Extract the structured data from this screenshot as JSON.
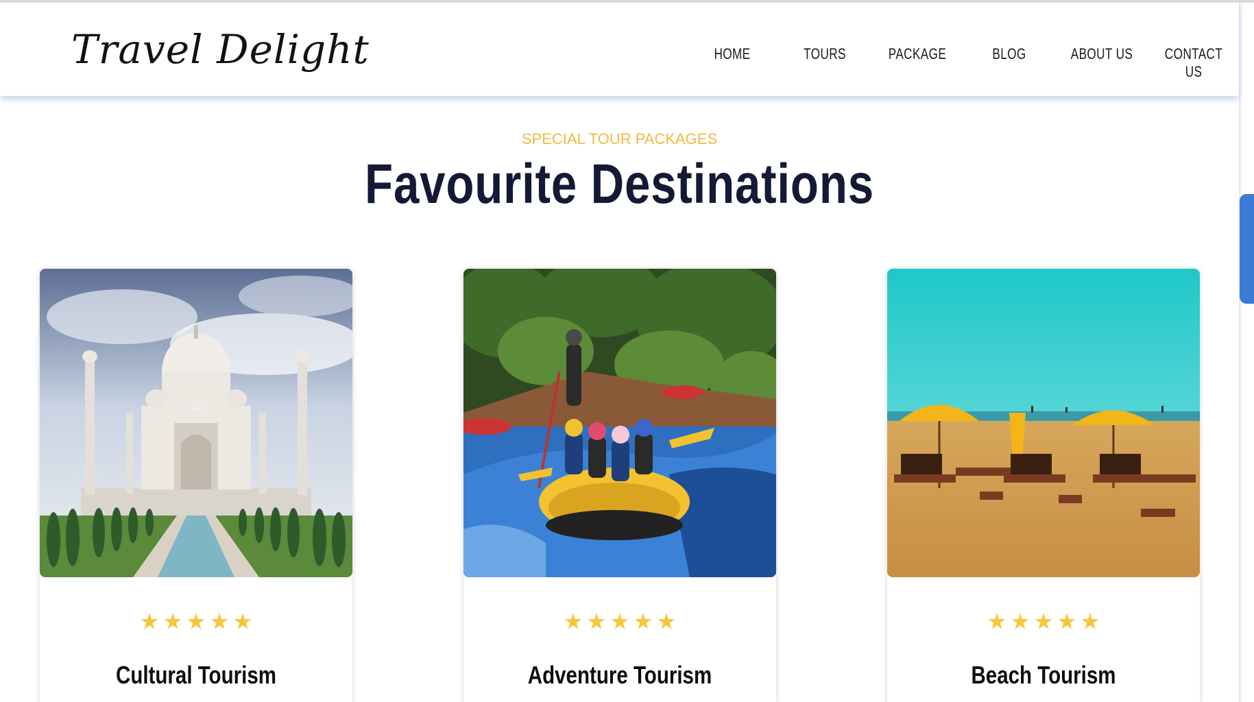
{
  "brand": {
    "logo_text": "Travel Delight"
  },
  "nav": {
    "items": [
      {
        "label": "HOME"
      },
      {
        "label": "TOURS"
      },
      {
        "label": "PACKAGE"
      },
      {
        "label": "BLOG"
      },
      {
        "label": "ABOUT US"
      },
      {
        "label": "CONTACT US"
      }
    ]
  },
  "section": {
    "eyebrow": "SPECIAL TOUR PACKAGES",
    "title": "Favourite Destinations"
  },
  "cards": [
    {
      "title": "Cultural Tourism",
      "rating": 5,
      "image": "taj-mahal-photo"
    },
    {
      "title": "Adventure Tourism",
      "rating": 5,
      "image": "river-rafting-photo"
    },
    {
      "title": "Beach Tourism",
      "rating": 5,
      "image": "beach-umbrellas-photo"
    }
  ],
  "colors": {
    "accent": "#f4b841",
    "heading": "#141a35",
    "star": "#f7c638",
    "scrollbar": "#3a7bd5"
  }
}
